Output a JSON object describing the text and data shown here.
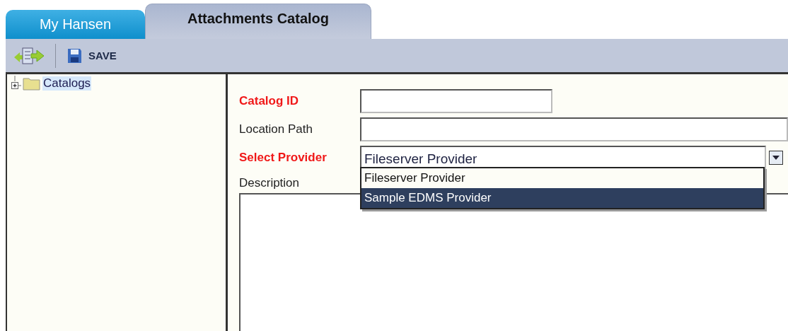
{
  "tabs": [
    {
      "label": "My Hansen",
      "selected": false
    },
    {
      "label": "Attachments Catalog",
      "selected": true
    }
  ],
  "toolbar": {
    "save_label": "SAVE"
  },
  "tree": {
    "items": [
      {
        "label": "Catalogs",
        "expanded": false,
        "selected": true
      }
    ]
  },
  "form": {
    "fields": [
      {
        "kind": "short_text",
        "label": "Catalog ID",
        "required": true
      },
      {
        "kind": "text",
        "label": "Location Path",
        "required": false
      },
      {
        "kind": "select",
        "label": "Select Provider",
        "required": true,
        "value": "Fileserver Provider",
        "open": true,
        "options": [
          {
            "label": "Fileserver Provider",
            "highlighted": false
          },
          {
            "label": "Sample EDMS Provider",
            "highlighted": true
          }
        ]
      },
      {
        "kind": "textarea",
        "label": "Description",
        "required": false
      }
    ]
  }
}
